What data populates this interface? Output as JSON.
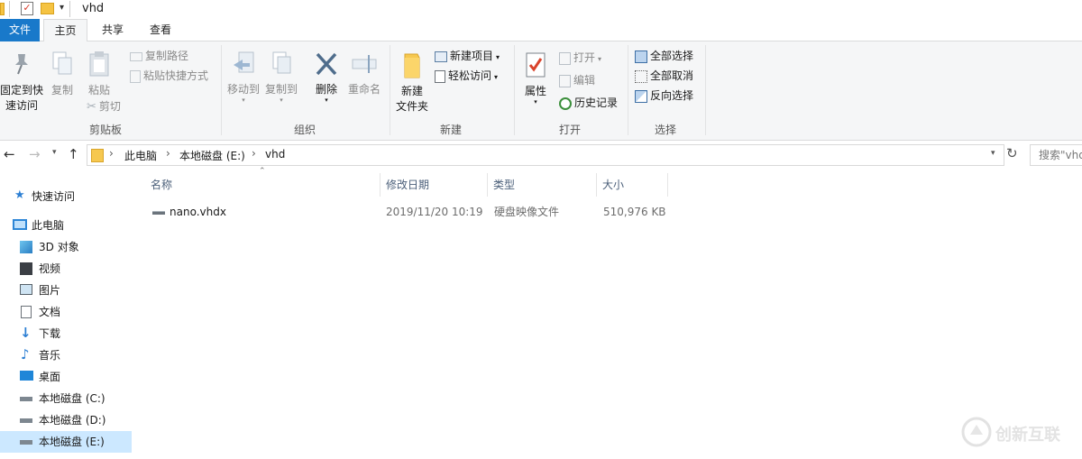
{
  "window": {
    "title": "vhd"
  },
  "tabs": [
    {
      "label": "文件"
    },
    {
      "label": "主页"
    },
    {
      "label": "共享"
    },
    {
      "label": "查看"
    }
  ],
  "ribbon": {
    "clipboard": {
      "group_label": "剪贴板",
      "pin_quick_access": "固定到快\n速访问",
      "copy": "复制",
      "paste": "粘贴",
      "copy_path": "复制路径",
      "paste_shortcut": "粘贴快捷方式",
      "cut": "剪切"
    },
    "organize": {
      "group_label": "组织",
      "move_to": "移动到",
      "copy_to": "复制到",
      "delete": "删除",
      "rename": "重命名"
    },
    "new": {
      "group_label": "新建",
      "new_folder": "新建\n文件夹",
      "new_item": "新建项目",
      "easy_access": "轻松访问"
    },
    "open": {
      "group_label": "打开",
      "properties": "属性",
      "open": "打开",
      "edit": "编辑",
      "history": "历史记录"
    },
    "select": {
      "group_label": "选择",
      "select_all": "全部选择",
      "select_none": "全部取消",
      "invert_selection": "反向选择"
    }
  },
  "address": {
    "crumbs": [
      "此电脑",
      "本地磁盘 (E:)",
      "vhd"
    ],
    "search_placeholder": "搜索\"vhd\""
  },
  "nav": {
    "items": [
      {
        "label": "快速访问",
        "icon": "star-icon"
      },
      {
        "label": "此电脑",
        "icon": "computer-icon"
      },
      {
        "label": "3D 对象",
        "icon": "cube-icon"
      },
      {
        "label": "视频",
        "icon": "video-icon"
      },
      {
        "label": "图片",
        "icon": "picture-icon"
      },
      {
        "label": "文档",
        "icon": "document-icon"
      },
      {
        "label": "下载",
        "icon": "download-icon"
      },
      {
        "label": "音乐",
        "icon": "music-icon"
      },
      {
        "label": "桌面",
        "icon": "desktop-icon"
      },
      {
        "label": "本地磁盘 (C:)",
        "icon": "drive-icon"
      },
      {
        "label": "本地磁盘 (D:)",
        "icon": "drive-icon"
      },
      {
        "label": "本地磁盘 (E:)",
        "icon": "drive-icon",
        "selected": true
      }
    ]
  },
  "files": {
    "columns": [
      "名称",
      "修改日期",
      "类型",
      "大小"
    ],
    "rows": [
      {
        "name": "nano.vhdx",
        "modified": "2019/11/20 10:19",
        "type": "硬盘映像文件",
        "size": "510,976 KB"
      }
    ]
  },
  "watermark": {
    "text": "创新互联"
  },
  "colors": {
    "file_tab": "#1979ca",
    "ribbon_bg": "#f5f6f7",
    "selection": "#cce8ff",
    "header_text": "#4c607a"
  }
}
